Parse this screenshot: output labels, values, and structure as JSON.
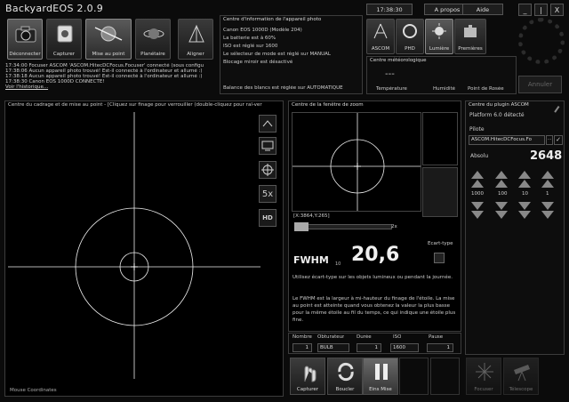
{
  "window": {
    "title": "BackyardEOS 2.0.9",
    "clock": "17:38:30",
    "about": "A propos",
    "help": "Aide",
    "minimize": "_",
    "maximize": "|",
    "close": "X"
  },
  "toolbar": {
    "buttons": [
      {
        "label": "Déconnecter",
        "icon": "camera-icon"
      },
      {
        "label": "Capturer",
        "icon": "capture-icon"
      },
      {
        "label": "Mise au point",
        "icon": "focus-icon"
      },
      {
        "label": "Planétaire",
        "icon": "planet-icon"
      },
      {
        "label": "Aligner",
        "icon": "align-icon"
      }
    ]
  },
  "log": {
    "lines": [
      "17:34:00  Focuser ASCOM 'ASCOM.HitecDCFocus.Focuser' connecté (sous configu",
      "17:38:06  Aucun appareil photo trouvé! Est-il connecté à l'ordinateur et allumé :)",
      "17:38:18  Aucun appareil photo trouvé! Est-il connecté à l'ordinateur et allumé :)",
      "17:38:30  Canon EOS 1000D CONNECTÉ!"
    ],
    "history_link": "Voir l'historique..."
  },
  "camera_info": {
    "title": "Centre d'information de l'appareil photo",
    "lines": [
      "Canon EOS 1000D   (Modèle 204)",
      "La batterie est à 60%",
      "ISO est réglé sur 1600",
      "Le sélecteur de mode est réglé sur MANUAL",
      "Blocage miroir est désactivé"
    ],
    "wb": "Balance des blancs est réglée sur AUTOMATIQUE"
  },
  "modules": [
    {
      "label": "ASCOM",
      "icon": "ascom-icon"
    },
    {
      "label": "PHD",
      "icon": "phd-icon"
    },
    {
      "label": "Lumière",
      "icon": "light-icon"
    },
    {
      "label": "Premières",
      "icon": "puzzle-icon"
    }
  ],
  "weather": {
    "title": "Centre météorologique",
    "dash": "---",
    "labels": [
      "Température",
      "Humidité",
      "Point de Rosée"
    ]
  },
  "abort": "Annuler",
  "framing": {
    "title": "Centre du cadrage et de mise au point - [Cliquez sur finage pour verrouiller (double-cliquez pour ral-ver",
    "footer": "Mouse Coordinates",
    "zoom_label": "5x"
  },
  "zoom": {
    "title": "Centre de la fenêtre de zoom",
    "coords": "[X:3864,Y:265]",
    "slider_label": "2x",
    "ecart_type": "Ecart-type"
  },
  "fwhm": {
    "label": "FWHM",
    "subscript": "10",
    "value": "20,6",
    "hint": "Utilisez écart-type sur les objets lumineux ou pendant la journée.",
    "desc": "Le FWHM est la largeur à mi-hauteur du finage de l'étoile. La mise au point est atteinte quand vous obtenez la valeur la plus basse pour la même étoile au fil du temps, ce qui indique une étoile plus fine."
  },
  "capture": {
    "headers": [
      "Nombre",
      "Obturateur",
      "Durée",
      "ISO",
      "Pause"
    ],
    "values": [
      "1",
      "BULB",
      "1",
      "1600",
      "1"
    ]
  },
  "actions": {
    "capture": "Capturer",
    "loop": "Boucler",
    "pause": "Eins Mise",
    "focuser": "Focuser",
    "telescope": "Télescope"
  },
  "plugin": {
    "title": "Centre du plugin ASCOM",
    "detected": "Platform 6.0 détecté",
    "pilot_label": "Pilote",
    "pilot_value": "ASCOM.HitecDCFocus.Fo",
    "pilot_more": "...",
    "abs_label": "Absolu",
    "abs_value": "2648",
    "steps": [
      "1000",
      "100",
      "10",
      "1"
    ]
  }
}
